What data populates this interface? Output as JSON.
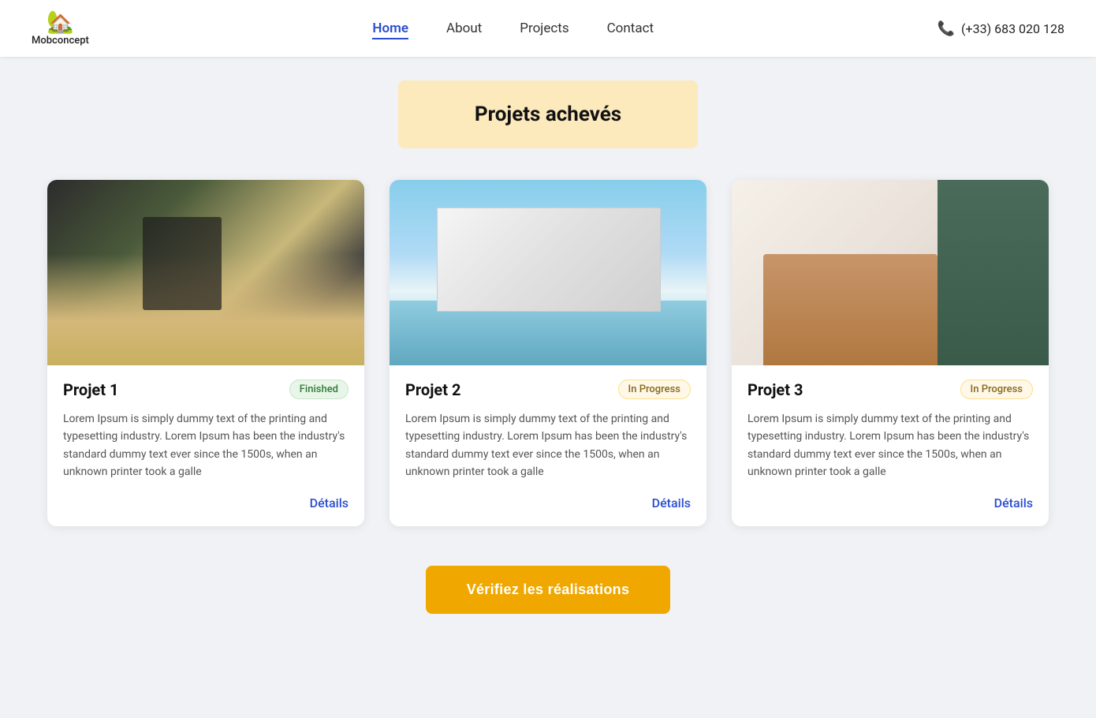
{
  "brand": {
    "icon": "🏠",
    "name": "Mobconcept"
  },
  "nav": {
    "links": [
      {
        "id": "home",
        "label": "Home",
        "active": true
      },
      {
        "id": "about",
        "label": "About",
        "active": false
      },
      {
        "id": "projects",
        "label": "Projects",
        "active": false
      },
      {
        "id": "contact",
        "label": "Contact",
        "active": false
      }
    ],
    "phone": "(+33) 683 020 128"
  },
  "section": {
    "title": "Projets achevés"
  },
  "projects": [
    {
      "id": "projet-1",
      "title": "Projet 1",
      "badge": "Finished",
      "badge_type": "finished",
      "description": "Lorem Ipsum is simply dummy text of the printing and typesetting industry. Lorem Ipsum has been the industry's standard dummy text ever since the 1500s, when an unknown printer took a galle",
      "details_label": "Détails",
      "image_class": "card-image-1"
    },
    {
      "id": "projet-2",
      "title": "Projet 2",
      "badge": "In Progress",
      "badge_type": "inprogress",
      "description": "Lorem Ipsum is simply dummy text of the printing and typesetting industry. Lorem Ipsum has been the industry's standard dummy text ever since the 1500s, when an unknown printer took a galle",
      "details_label": "Détails",
      "image_class": "card-image-2"
    },
    {
      "id": "projet-3",
      "title": "Projet 3",
      "badge": "In Progress",
      "badge_type": "inprogress",
      "description": "Lorem Ipsum is simply dummy text of the printing and typesetting industry. Lorem Ipsum has been the industry's standard dummy text ever since the 1500s, when an unknown printer took a galle",
      "details_label": "Détails",
      "image_class": "card-image-3"
    }
  ],
  "cta": {
    "label": "Vérifiez les réalisations"
  }
}
